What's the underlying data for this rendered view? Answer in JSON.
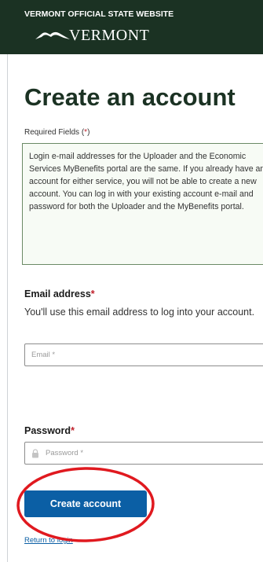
{
  "header": {
    "site_label": "VERMONT OFFICIAL STATE WEBSITE",
    "logo_text": "VERMONT",
    "logo_icon": "mountain-icon",
    "background_color": "#1b3223"
  },
  "page": {
    "title": "Create an account",
    "required_label": "Required Fields (",
    "required_star": "*",
    "required_close": ")",
    "info_text": "Login e-mail addresses for the Uploader and the Economic Services MyBenefits portal are the same. If you already have an account for either service, you will not be able to create a new account. You can log in with your existing account e-mail and password for both the Uploader and the MyBenefits portal."
  },
  "email": {
    "label": "Email address",
    "star": "*",
    "hint": "You'll use this email address to log into your account.",
    "placeholder": "Email *",
    "value": ""
  },
  "password": {
    "label": "Password",
    "star": "*",
    "placeholder": "Password *",
    "value": "",
    "icon": "lock-icon"
  },
  "actions": {
    "submit_label": "Create account",
    "return_label": "Return to login"
  },
  "colors": {
    "accent": "#0b5fa5",
    "title": "#1b3223",
    "required": "#c0202b",
    "highlight_annotation": "#e0191f"
  }
}
